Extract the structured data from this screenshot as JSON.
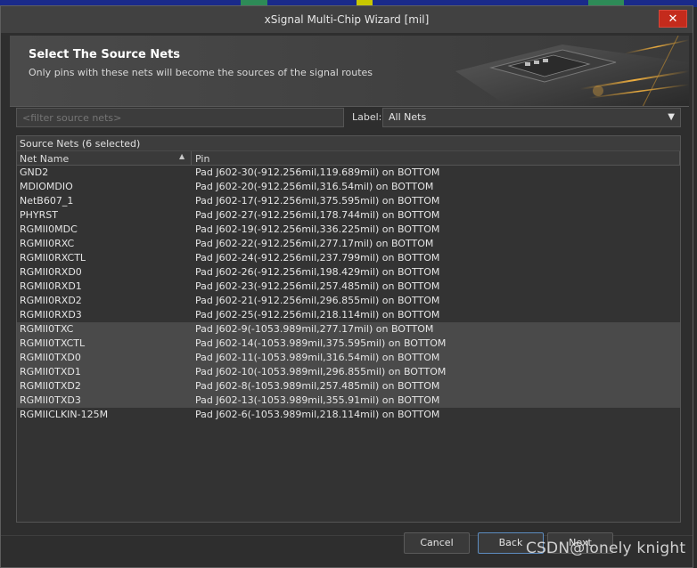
{
  "window": {
    "title": "xSignal Multi-Chip Wizard [mil]",
    "close_glyph": "✕"
  },
  "header": {
    "title": "Select The Source Nets",
    "subtitle": "Only pins with these nets will become the sources of the signal routes"
  },
  "filter": {
    "placeholder": "<filter source nets>",
    "value": ""
  },
  "label_select": {
    "label": "Label:",
    "value": "All Nets"
  },
  "grid": {
    "group_title": "Source Nets (6 selected)",
    "columns": [
      "Net Name",
      "Pin"
    ],
    "rows": [
      {
        "net": "GND2",
        "pin": "Pad J602-30(-912.256mil,119.689mil) on BOTTOM",
        "selected": false
      },
      {
        "net": "MDIOMDIO",
        "pin": "Pad J602-20(-912.256mil,316.54mil) on BOTTOM",
        "selected": false
      },
      {
        "net": "NetB607_1",
        "pin": "Pad J602-17(-912.256mil,375.595mil) on BOTTOM",
        "selected": false
      },
      {
        "net": "PHYRST",
        "pin": "Pad J602-27(-912.256mil,178.744mil) on BOTTOM",
        "selected": false
      },
      {
        "net": "RGMII0MDC",
        "pin": "Pad J602-19(-912.256mil,336.225mil) on BOTTOM",
        "selected": false
      },
      {
        "net": "RGMII0RXC",
        "pin": "Pad J602-22(-912.256mil,277.17mil) on BOTTOM",
        "selected": false
      },
      {
        "net": "RGMII0RXCTL",
        "pin": "Pad J602-24(-912.256mil,237.799mil) on BOTTOM",
        "selected": false
      },
      {
        "net": "RGMII0RXD0",
        "pin": "Pad J602-26(-912.256mil,198.429mil) on BOTTOM",
        "selected": false
      },
      {
        "net": "RGMII0RXD1",
        "pin": "Pad J602-23(-912.256mil,257.485mil) on BOTTOM",
        "selected": false
      },
      {
        "net": "RGMII0RXD2",
        "pin": "Pad J602-21(-912.256mil,296.855mil) on BOTTOM",
        "selected": false
      },
      {
        "net": "RGMII0RXD3",
        "pin": "Pad J602-25(-912.256mil,218.114mil) on BOTTOM",
        "selected": false
      },
      {
        "net": "RGMII0TXC",
        "pin": "Pad J602-9(-1053.989mil,277.17mil) on BOTTOM",
        "selected": true
      },
      {
        "net": "RGMII0TXCTL",
        "pin": "Pad J602-14(-1053.989mil,375.595mil) on BOTTOM",
        "selected": true
      },
      {
        "net": "RGMII0TXD0",
        "pin": "Pad J602-11(-1053.989mil,316.54mil) on BOTTOM",
        "selected": true
      },
      {
        "net": "RGMII0TXD1",
        "pin": "Pad J602-10(-1053.989mil,296.855mil) on BOTTOM",
        "selected": true
      },
      {
        "net": "RGMII0TXD2",
        "pin": "Pad J602-8(-1053.989mil,257.485mil) on BOTTOM",
        "selected": true
      },
      {
        "net": "RGMII0TXD3",
        "pin": "Pad J602-13(-1053.989mil,355.91mil) on BOTTOM",
        "selected": true
      },
      {
        "net": "RGMIICLKIN-125M",
        "pin": "Pad J602-6(-1053.989mil,218.114mil) on BOTTOM",
        "selected": false
      }
    ]
  },
  "buttons": {
    "cancel": "Cancel",
    "back": "Back",
    "next": "Next"
  },
  "watermark": "CSDN@lonely knight",
  "colors": {
    "accent": "#5d8cc0",
    "close": "#c42b1c",
    "selected_row": "#4a4a4a"
  }
}
